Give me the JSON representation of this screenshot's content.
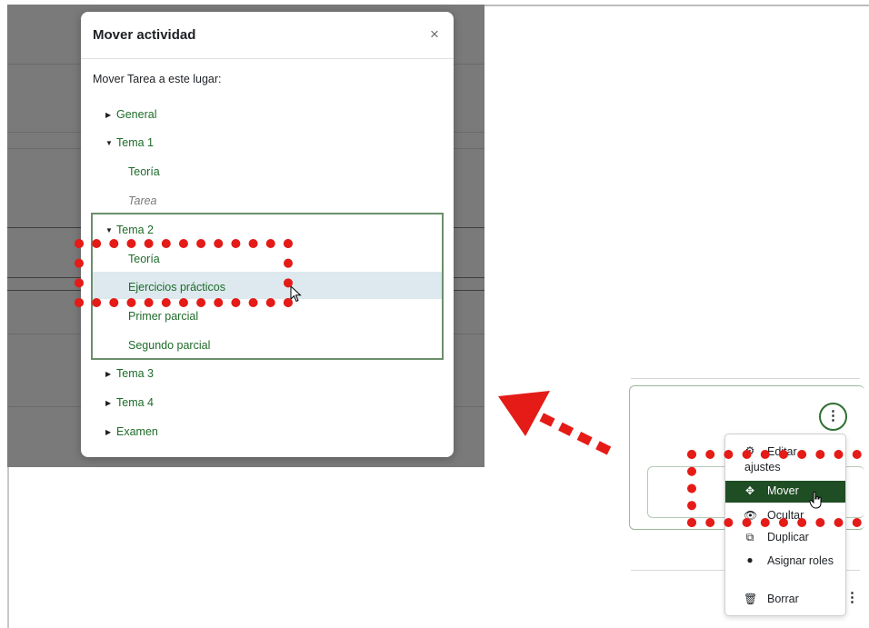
{
  "modal": {
    "title": "Mover actividad",
    "close_glyph": "×",
    "instruction": "Mover Tarea a este lugar:",
    "sections": [
      {
        "label": "General",
        "caret": "▶"
      },
      {
        "label": "Tema 1",
        "caret": "▼"
      },
      {
        "label": "Tema 2",
        "caret": "▼"
      },
      {
        "label": "Tema 3",
        "caret": "▶"
      },
      {
        "label": "Tema 4",
        "caret": "▶"
      },
      {
        "label": "Examen",
        "caret": "▶"
      }
    ],
    "tema1_activities": [
      "Teoría",
      "Tarea"
    ],
    "tema2_activities": [
      "Teoría",
      "Ejercicios prácticos",
      "Primer parcial",
      "Segundo parcial"
    ]
  },
  "context_menu": {
    "kebab_glyph": "⋮",
    "items": [
      {
        "icon": "gear-icon",
        "glyph": "⚙",
        "label": "Editar ajustes"
      },
      {
        "icon": "move-icon",
        "glyph": "✥",
        "label": "Mover"
      },
      {
        "icon": "eye-icon",
        "glyph": "👁",
        "label": "Ocultar"
      },
      {
        "icon": "copy-icon",
        "glyph": "⧉",
        "label": "Duplicar"
      },
      {
        "icon": "user-circle-icon",
        "glyph": "●",
        "label": "Asignar roles"
      },
      {
        "icon": "trash-icon",
        "glyph": "🗑",
        "label": "Borrar"
      }
    ]
  },
  "colors": {
    "annotation_red": "#e41b17",
    "link_green": "#1f6b2a",
    "active_menu": "#1f4d24",
    "selected_row": "#dde9ee"
  }
}
